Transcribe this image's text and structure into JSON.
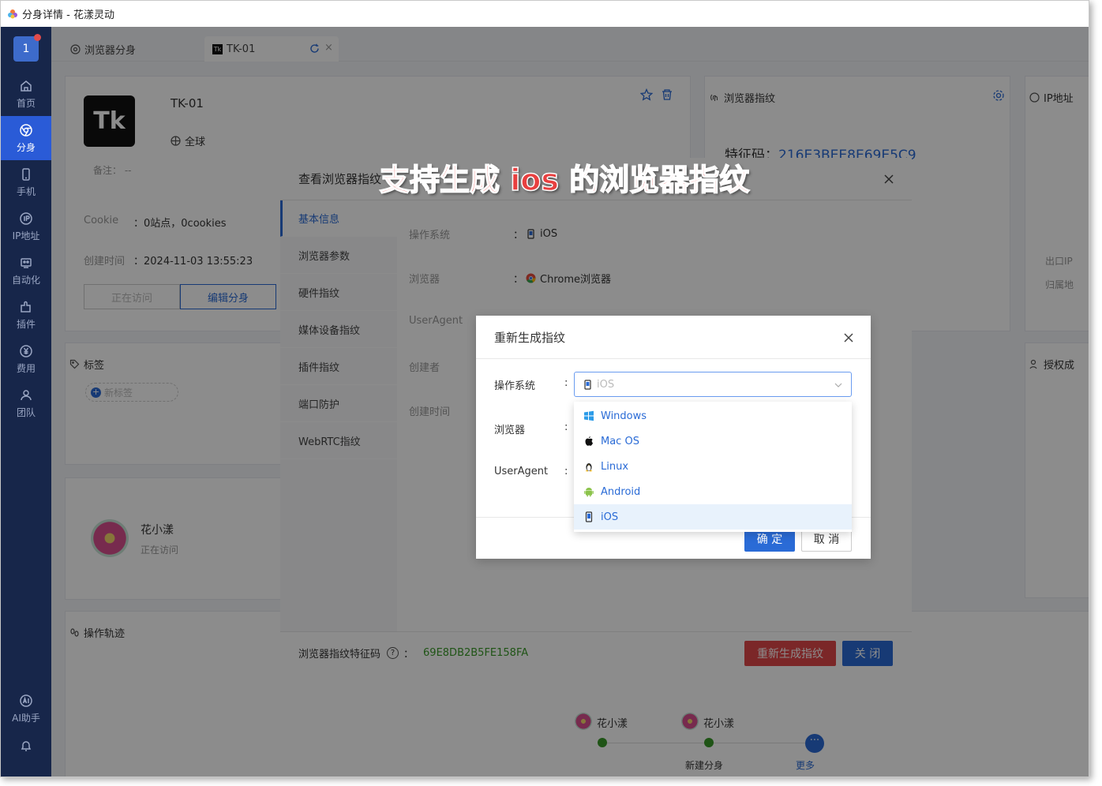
{
  "window": {
    "title": "分身详情 - 花漾灵动"
  },
  "sidebar": {
    "avatar_text": "1",
    "items": [
      {
        "label": "首页",
        "icon": "home-icon"
      },
      {
        "label": "分身",
        "icon": "chrome-icon",
        "active": true
      },
      {
        "label": "手机",
        "icon": "phone-icon"
      },
      {
        "label": "IP地址",
        "icon": "ip-icon"
      },
      {
        "label": "自动化",
        "icon": "robot-icon"
      },
      {
        "label": "插件",
        "icon": "puzzle-icon"
      },
      {
        "label": "费用",
        "icon": "yen-icon"
      },
      {
        "label": "团队",
        "icon": "team-icon"
      }
    ],
    "ai_label": "AI助手"
  },
  "tabs": [
    {
      "label": "浏览器分身"
    },
    {
      "label": "TK-01",
      "active": true
    }
  ],
  "profile": {
    "logo_text": "Tk",
    "name": "TK-01",
    "region": "全球",
    "note_label": "备注：",
    "note_value": "--",
    "cookie_label": "Cookie",
    "cookie_value": "0站点，0cookies",
    "created_label": "创建时间",
    "created_value": "2024-11-03 13:55:23",
    "visiting_btn": "正在访问",
    "edit_btn": "编辑分身"
  },
  "fingerprint_card": {
    "title": "浏览器指纹",
    "feature_label": "特征码：",
    "feature_value": "216E3BEE8E69E5C9"
  },
  "ip_card": {
    "title": "IP地址",
    "exit_ip": "出口IP",
    "belongs": "归属地"
  },
  "tags_card": {
    "title": "标签",
    "new_tag": "新标签"
  },
  "auth_card": {
    "title": "授权成"
  },
  "user_card": {
    "name": "花小漾",
    "status": "正在访问"
  },
  "track_card": {
    "title": "操作轨迹",
    "nodes": [
      "花小漾",
      "花小漾"
    ],
    "captions": [
      "新建分身",
      "更多"
    ]
  },
  "dialog_view": {
    "title": "查看浏览器指纹",
    "menu": [
      "基本信息",
      "浏览器参数",
      "硬件指纹",
      "媒体设备指纹",
      "插件指纹",
      "端口防护",
      "WebRTC指纹"
    ],
    "fields": [
      {
        "label": "操作系统",
        "value": "iOS"
      },
      {
        "label": "浏览器",
        "value": "Chrome浏览器"
      },
      {
        "label": "UserAgent",
        "value": ""
      },
      {
        "label": "创建者",
        "value": ""
      },
      {
        "label": "创建时间",
        "value": ""
      }
    ],
    "footer_label": "浏览器指纹特征码",
    "footer_code": "69E8DB2B5FE158FA",
    "regen_btn": "重新生成指纹",
    "close_btn": "关 闭"
  },
  "dialog_regen": {
    "title": "重新生成指纹",
    "os_label": "操作系统",
    "browser_label": "浏览器",
    "ua_label": "UserAgent",
    "select_value": "iOS",
    "options": [
      "Windows",
      "Mac OS",
      "Linux",
      "Android",
      "iOS"
    ],
    "ok_btn": "确 定",
    "cancel_btn": "取 消"
  },
  "banner_text": "支持生成 ios 的浏览器指纹",
  "colors": {
    "primary": "#2a6bd6",
    "danger": "#e0484a",
    "sidebar": "#17264a",
    "code_green": "#3a9a28"
  }
}
